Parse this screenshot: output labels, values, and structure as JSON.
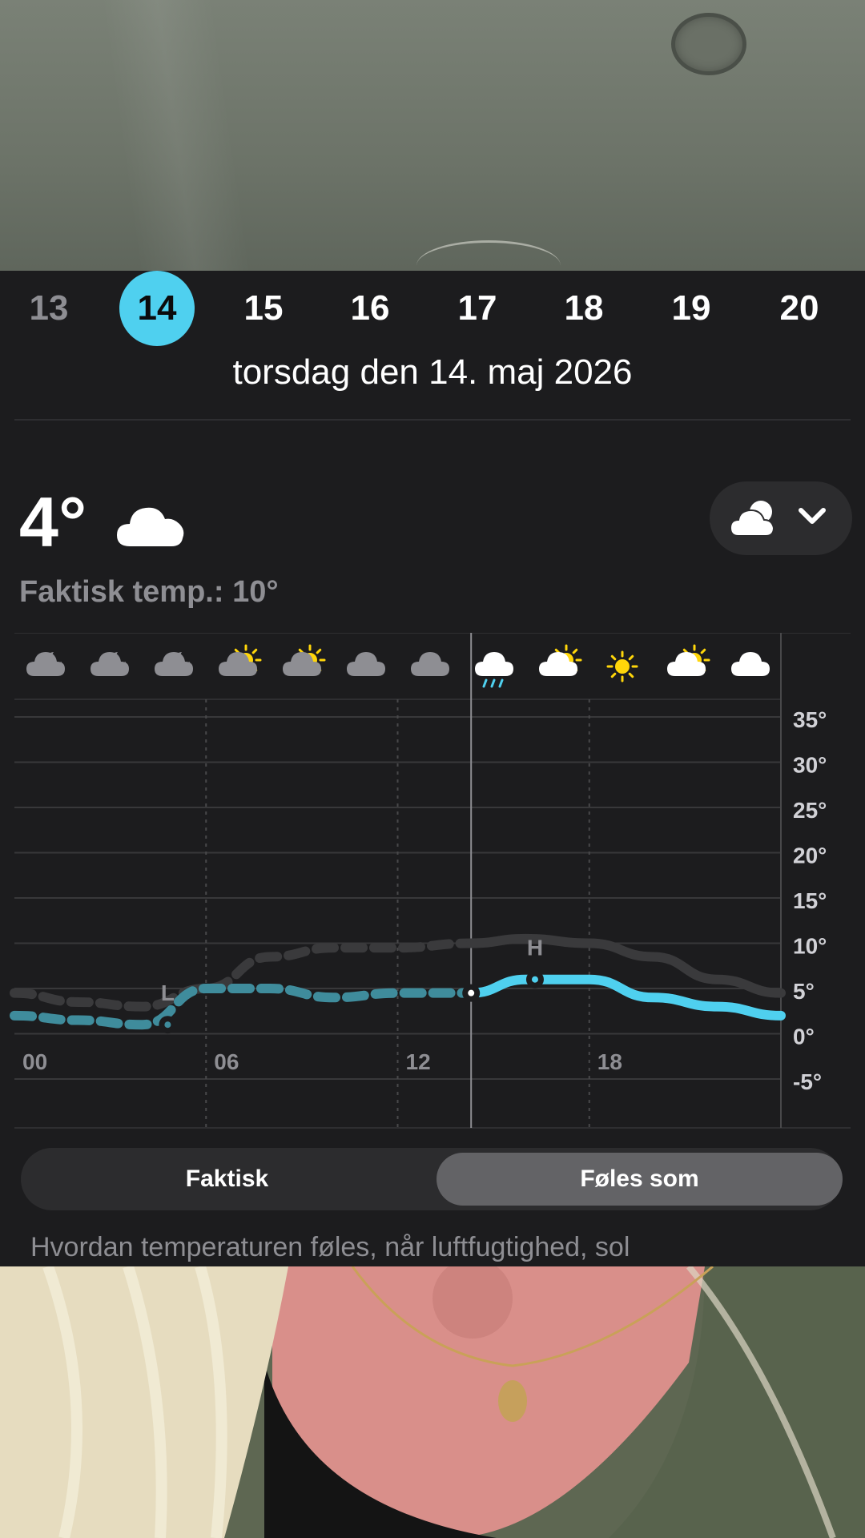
{
  "days": [
    {
      "label": "13",
      "state": "past"
    },
    {
      "label": "14",
      "state": "selected"
    },
    {
      "label": "15",
      "state": "future"
    },
    {
      "label": "16",
      "state": "future"
    },
    {
      "label": "17",
      "state": "future"
    },
    {
      "label": "18",
      "state": "future"
    },
    {
      "label": "19",
      "state": "future"
    },
    {
      "label": "20",
      "state": "future"
    }
  ],
  "full_date": "torsdag den 14. maj 2026",
  "current": {
    "temp": "4°",
    "icon": "cloud-icon",
    "actual_temp_label": "Faktisk temp.: 10°"
  },
  "layer_picker": {
    "icon": "partly-cloudy-icon",
    "chevron": "chevron-down-icon"
  },
  "hourly_icons": [
    "cloud-moon-icon",
    "cloud-moon-icon",
    "cloud-moon-icon",
    "partly-sunny-icon",
    "partly-sunny-icon",
    "cloud-icon",
    "cloud-icon",
    "rain-icon",
    "partly-sunny-icon",
    "sun-icon",
    "partly-sunny-icon",
    "cloud-icon"
  ],
  "chart_data": {
    "type": "line",
    "x_ticks": [
      "00",
      "06",
      "12",
      "18"
    ],
    "y_ticks": [
      "35°",
      "30°",
      "25°",
      "20°",
      "15°",
      "10°",
      "5°",
      "0°",
      "-5°"
    ],
    "ylim": [
      -5,
      35
    ],
    "xlim": [
      0,
      24
    ],
    "now_hour": 14.3,
    "series": [
      {
        "name": "Faktisk",
        "color": "#3a3a3c",
        "x": [
          0,
          2,
          4,
          6,
          8,
          10,
          12,
          14.3,
          16,
          18,
          20,
          22,
          24
        ],
        "y": [
          4.5,
          3.5,
          3,
          5,
          8.5,
          9.5,
          9.5,
          10,
          10.5,
          10,
          8.5,
          6,
          4.5
        ]
      },
      {
        "name": "Føles som",
        "color": "#4fd0ef",
        "x": [
          0,
          2,
          4,
          6,
          8,
          10,
          12,
          14.3,
          16,
          18,
          20,
          22,
          24
        ],
        "y": [
          2,
          1.5,
          1,
          5,
          5,
          4,
          4.5,
          4.5,
          6,
          6,
          4,
          3,
          2
        ]
      }
    ],
    "markers": [
      {
        "label": "L",
        "x": 4.8,
        "y": 1
      },
      {
        "label": "H",
        "x": 16.3,
        "y": 6
      }
    ]
  },
  "toggle": {
    "left": "Faktisk",
    "right": "Føles som",
    "active": "right"
  },
  "description": "Hvordan temperaturen føles, når luftfugtighed, sol"
}
